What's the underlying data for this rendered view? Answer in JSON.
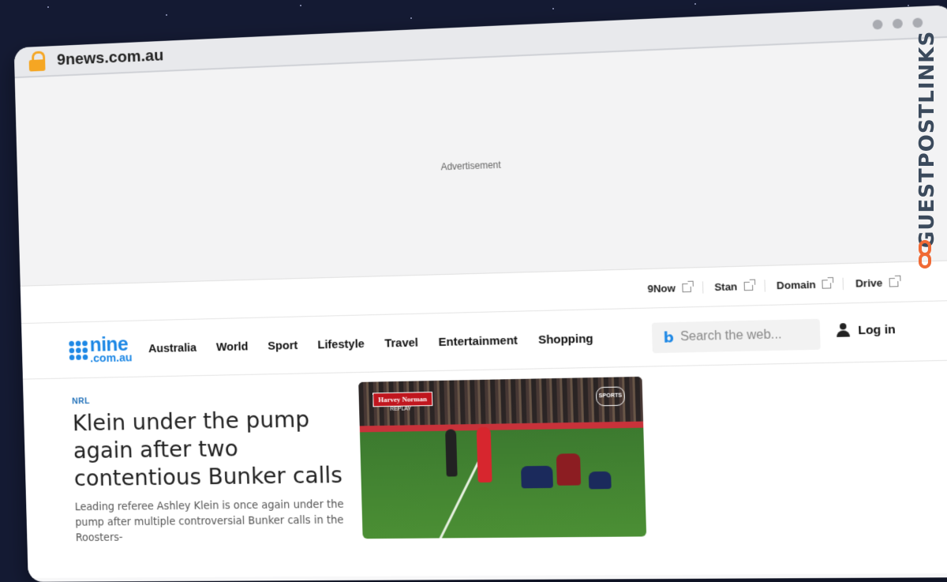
{
  "browser": {
    "url": "9news.com.au"
  },
  "ad": {
    "label": "Advertisement"
  },
  "utility_links": [
    {
      "label": "9Now"
    },
    {
      "label": "Stan"
    },
    {
      "label": "Domain"
    },
    {
      "label": "Drive"
    }
  ],
  "nav": {
    "logo_top": "nine",
    "logo_bottom": ".com.au",
    "items": [
      "Australia",
      "World",
      "Sport",
      "Lifestyle",
      "Travel",
      "Entertainment",
      "Shopping"
    ],
    "search_placeholder": "Search the web...",
    "login_label": "Log in"
  },
  "article": {
    "category": "NRL",
    "headline": "Klein under the pump again after two contentious Bunker calls",
    "summary": "Leading referee Ashley Klein is once again under the pump after multiple controversial Bunker calls in the Roosters-",
    "image_overlay": {
      "sponsor": "Harvey Norman",
      "tag": "REPLAY",
      "network": "SPORTS"
    }
  },
  "watermark": {
    "text": "GUESTPOSTLINKS"
  },
  "colors": {
    "accent": "#1e88e5",
    "watermark_icon": "#f06a35",
    "lock": "#f5a623"
  }
}
